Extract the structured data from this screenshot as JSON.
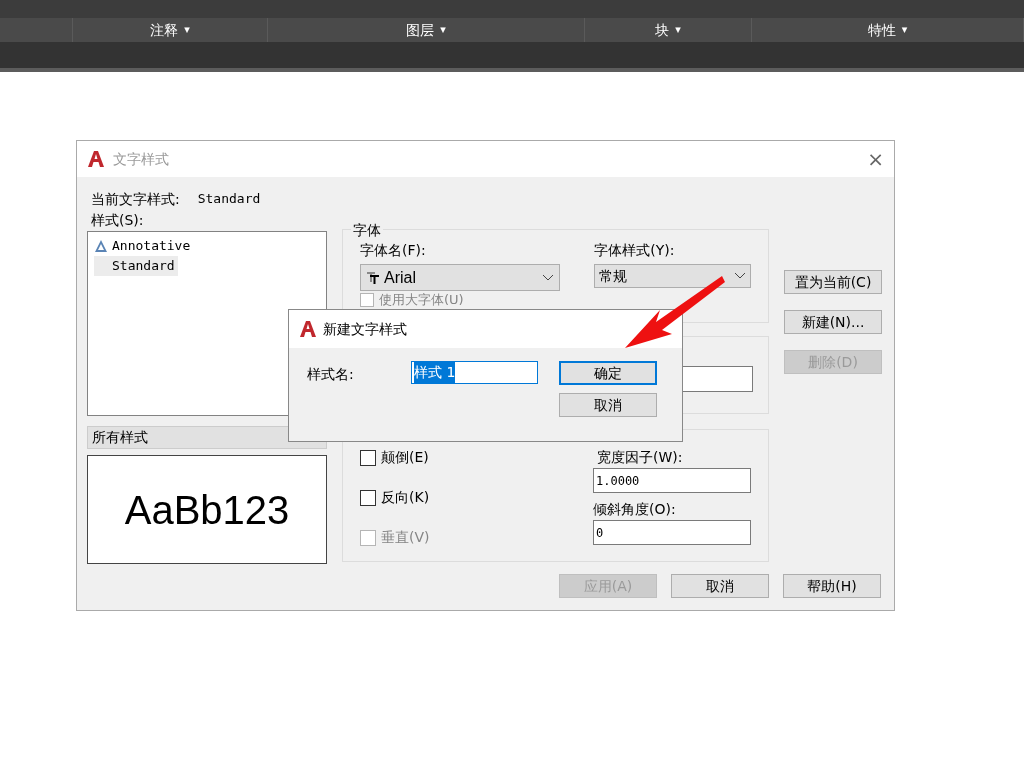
{
  "ribbon": {
    "panels": [
      {
        "label": "注释",
        "caret": "▾"
      },
      {
        "label": "图层",
        "caret": "▾"
      },
      {
        "label": "块",
        "caret": "▾"
      },
      {
        "label": "特性",
        "caret": "▾"
      }
    ]
  },
  "dialog": {
    "title": "文字样式",
    "close": "×",
    "current_label": "当前文字样式:",
    "current_value": "Standard",
    "styles_label": "样式(S):",
    "styles": [
      {
        "name": "Annotative",
        "kind": "annotative",
        "selected": false
      },
      {
        "name": "Standard",
        "kind": "plain",
        "selected": true
      }
    ],
    "filter": "所有样式",
    "preview": "AaBb123",
    "font_group": {
      "legend": "字体",
      "font_name_label": "字体名(F):",
      "font_name": "Arial",
      "font_style_label": "字体样式(Y):",
      "font_style": "常规",
      "big_font": {
        "label": "使用大字体(U)",
        "checked": false,
        "disabled": true
      }
    },
    "effects": [
      {
        "label": "颠倒(E)",
        "checked": false,
        "disabled": false
      },
      {
        "label": "反向(K)",
        "checked": false,
        "disabled": false
      },
      {
        "label": "垂直(V)",
        "checked": false,
        "disabled": true
      }
    ],
    "width_label": "宽度因子(W):",
    "width_value": "1.0000",
    "oblique_label": "倾斜角度(O):",
    "oblique_value": "0",
    "side_buttons": [
      {
        "label": "置为当前(C)",
        "disabled": false
      },
      {
        "label": "新建(N)...",
        "disabled": false
      },
      {
        "label": "删除(D)",
        "disabled": true
      }
    ],
    "bottom_buttons": [
      {
        "label": "应用(A)",
        "disabled": true
      },
      {
        "label": "取消",
        "disabled": false
      },
      {
        "label": "帮助(H)",
        "disabled": false
      }
    ]
  },
  "new_style_dialog": {
    "title": "新建文字样式",
    "name_label": "样式名:",
    "name_value": "样式 1",
    "buttons": [
      {
        "label": "确定",
        "selected": true
      },
      {
        "label": "取消",
        "selected": false
      }
    ]
  }
}
